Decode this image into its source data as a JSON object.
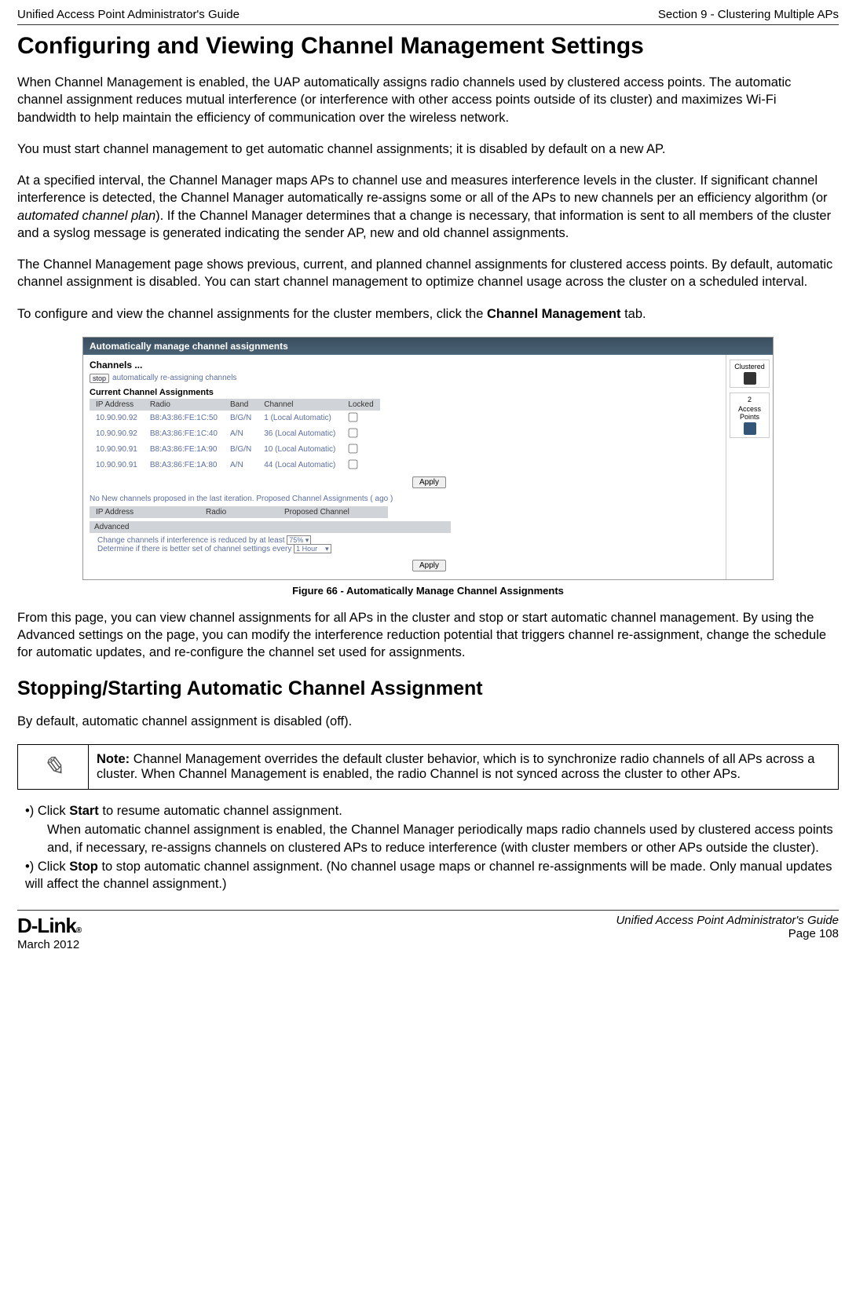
{
  "header": {
    "left": "Unified Access Point Administrator's Guide",
    "right": "Section 9 - Clustering Multiple APs"
  },
  "heading1": "Configuring and Viewing Channel Management Settings",
  "para1": "When Channel Management is enabled, the UAP automatically assigns radio channels used by clustered access points. The automatic channel assignment reduces mutual interference (or interference with other access points outside of its cluster) and maximizes Wi-Fi bandwidth to help maintain the efficiency of communication over the wireless network.",
  "para2": "You must start channel management to get automatic channel assignments; it is disabled by default on a new AP.",
  "para3a": "At a specified interval, the Channel Manager maps APs to channel use and measures interference levels in the cluster. If significant channel interference is detected, the Channel Manager automatically re-assigns some or all of the APs to new channels per an efficiency algorithm (or ",
  "para3_italic": "automated channel plan",
  "para3b": "). If the Channel Manager determines that a change is necessary, that information is sent to all members of the cluster and a syslog message is generated indicating the sender AP, new and old channel assignments.",
  "para4": "The Channel Management page shows previous, current, and planned channel assignments for clustered access points. By default, automatic channel assignment is disabled. You can start channel management to optimize channel usage across the cluster on a scheduled interval.",
  "para5a": "To configure and view the channel assignments for the cluster members, click the ",
  "para5_bold": "Channel Management",
  "para5b": " tab.",
  "figure": {
    "titlebar": "Automatically manage channel assignments",
    "channels_label": "Channels ...",
    "stop_button": "stop",
    "stop_text": "automatically re-assigning channels",
    "current_heading": "Current Channel Assignments",
    "table_headers": {
      "ip": "IP Address",
      "radio": "Radio",
      "band": "Band",
      "channel": "Channel",
      "locked": "Locked"
    },
    "rows": [
      {
        "ip": "10.90.90.92",
        "radio": "B8:A3:86:FE:1C:50",
        "band": "B/G/N",
        "channel": "1 (Local Automatic)"
      },
      {
        "ip": "10.90.90.92",
        "radio": "B8:A3:86:FE:1C:40",
        "band": "A/N",
        "channel": "36 (Local Automatic)"
      },
      {
        "ip": "10.90.90.91",
        "radio": "B8:A3:86:FE:1A:90",
        "band": "B/G/N",
        "channel": "10 (Local Automatic)"
      },
      {
        "ip": "10.90.90.91",
        "radio": "B8:A3:86:FE:1A:80",
        "band": "A/N",
        "channel": "44 (Local Automatic)"
      }
    ],
    "apply_label": "Apply",
    "proposed_note": "No New channels proposed in the last iteration. Proposed Channel Assignments ( ago )",
    "proposed_headers": {
      "ip": "IP Address",
      "radio": "Radio",
      "proposed": "Proposed Channel"
    },
    "advanced_label": "Advanced",
    "adv_line1_a": "Change channels if interference is reduced by at least",
    "adv_line1_value": "75%",
    "adv_line2_a": "Determine if there is better set of channel settings every",
    "adv_line2_value": "1 Hour",
    "side": {
      "clustered": "Clustered",
      "ap_count": "2",
      "ap_label": "Access Points"
    }
  },
  "figure_caption": "Figure 66 - Automatically Manage Channel Assignments",
  "para6": "From this page, you can view channel assignments for all APs in the cluster and stop or start automatic channel management. By using the Advanced settings on the page, you can modify the interference reduction potential that triggers channel re-assignment, change the schedule for automatic updates, and re-configure the channel set used for assignments.",
  "heading2": "Stopping/Starting Automatic Channel Assignment",
  "para7": "By default, automatic channel assignment is disabled (off).",
  "note": {
    "bold": "Note:",
    "text": " Channel Management overrides the default cluster behavior, which is to synchronize radio channels of all APs across a cluster. When Channel Management is enabled, the radio Channel is not synced across the cluster to other APs."
  },
  "bullets": {
    "b1_prefix": "•)  Click ",
    "b1_bold": "Start",
    "b1_rest": " to resume automatic channel assignment.",
    "b1_sub": "When automatic channel assignment is enabled, the Channel Manager periodically maps radio channels used by clustered access points and, if necessary, re-assigns channels on clustered APs to reduce interference (with cluster members or other APs outside the cluster).",
    "b2_prefix": "•)  Click ",
    "b2_bold": "Stop",
    "b2_rest": " to stop automatic channel assignment. (No channel usage maps or channel re-assignments will be made. Only manual updates will affect the channel assignment.)"
  },
  "footer": {
    "logo": "D-Link",
    "date": "March 2012",
    "right_title": "Unified Access Point Administrator's Guide",
    "page": "Page 108"
  }
}
